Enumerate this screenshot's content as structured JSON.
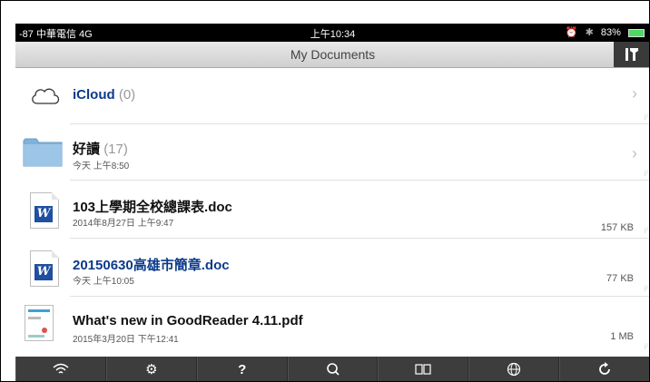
{
  "status": {
    "carrier": "-87 中華電信 4G",
    "time": "上午10:34",
    "alarm": "⏰",
    "bluetooth": "✱",
    "battery": "83%"
  },
  "nav": {
    "title": "My Documents",
    "tools_glyph": "⚒"
  },
  "rows": [
    {
      "name": "iCloud",
      "count": "(0)",
      "sub": "",
      "size": ""
    },
    {
      "name": "好讀",
      "count": "(17)",
      "sub": "今天 上午8:50",
      "size": ""
    },
    {
      "name": "103上學期全校總課表.doc",
      "count": "",
      "sub": "2014年8月27日 上午9:47",
      "size": "157 KB"
    },
    {
      "name": "20150630高雄市簡章.doc",
      "count": "",
      "sub": "今天 上午10:05",
      "size": "77 KB"
    },
    {
      "name": "What's new in GoodReader 4.11.pdf",
      "count": "",
      "sub": "2015年3月20日 下午12:41",
      "size": "1 MB"
    }
  ],
  "toolbar": {
    "wifi": "📶",
    "settings": "⚙",
    "help": "?",
    "search": "🔍",
    "reader": "📖",
    "web": "🌐",
    "refresh": "⟳"
  },
  "colors": {
    "link_blue": "#0b3a8a",
    "toolbar_bg": "#3d3d3d",
    "folder_blue": "#7fb1d9"
  }
}
